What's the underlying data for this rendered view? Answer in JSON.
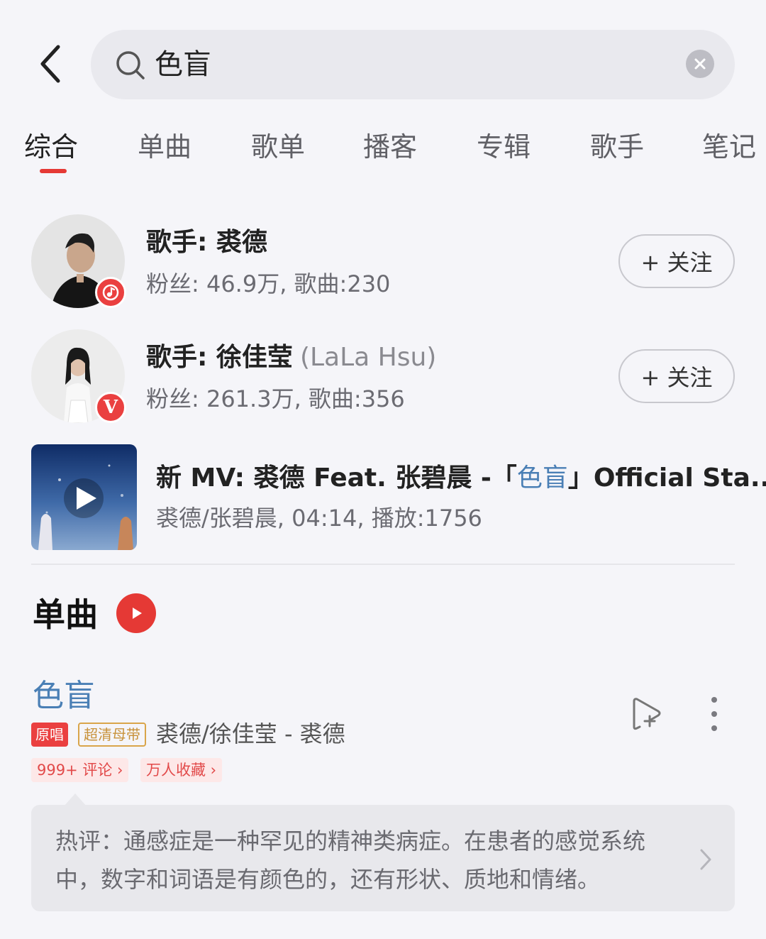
{
  "search": {
    "query": "色盲"
  },
  "tabs": [
    {
      "label": "综合",
      "active": true
    },
    {
      "label": "单曲",
      "active": false
    },
    {
      "label": "歌单",
      "active": false
    },
    {
      "label": "播客",
      "active": false
    },
    {
      "label": "专辑",
      "active": false
    },
    {
      "label": "歌手",
      "active": false
    },
    {
      "label": "笔记",
      "active": false
    }
  ],
  "artists": [
    {
      "name": "歌手: 裘德",
      "english_name": "",
      "meta": "粉丝: 46.9万, 歌曲:230",
      "badge_icon": "music-note-icon",
      "follow_label": "+ 关注"
    },
    {
      "name": "歌手: 徐佳莹",
      "english_name": "(LaLa Hsu)",
      "meta": "粉丝: 261.3万, 歌曲:356",
      "badge_icon": "verified-v-icon",
      "badge_text": "V",
      "follow_label": "+ 关注"
    }
  ],
  "mv": {
    "title_prefix": "新 MV: 裘德 Feat. 张碧晨 -「",
    "title_highlight": "色盲",
    "title_suffix": "」Official Sta...",
    "meta": "裘德/张碧晨,  04:14, 播放:1756"
  },
  "songs_section": {
    "title": "单曲"
  },
  "song": {
    "title": "色盲",
    "tag_original": "原唱",
    "tag_quality": "超清母带",
    "artist": "裘德/徐佳莹 - 裘德",
    "chip_comments": "999+ 评论 ›",
    "chip_favorites": "万人收藏 ›"
  },
  "hot_comment": {
    "text": "热评：通感症是一种罕见的精神类病症。在患者的感觉系统中，数字和词语是有颜色的，还有形状、质地和情绪。"
  },
  "colors": {
    "accent": "#e53935",
    "highlight_blue": "#4a7fb5",
    "background": "#f5f5f9"
  }
}
